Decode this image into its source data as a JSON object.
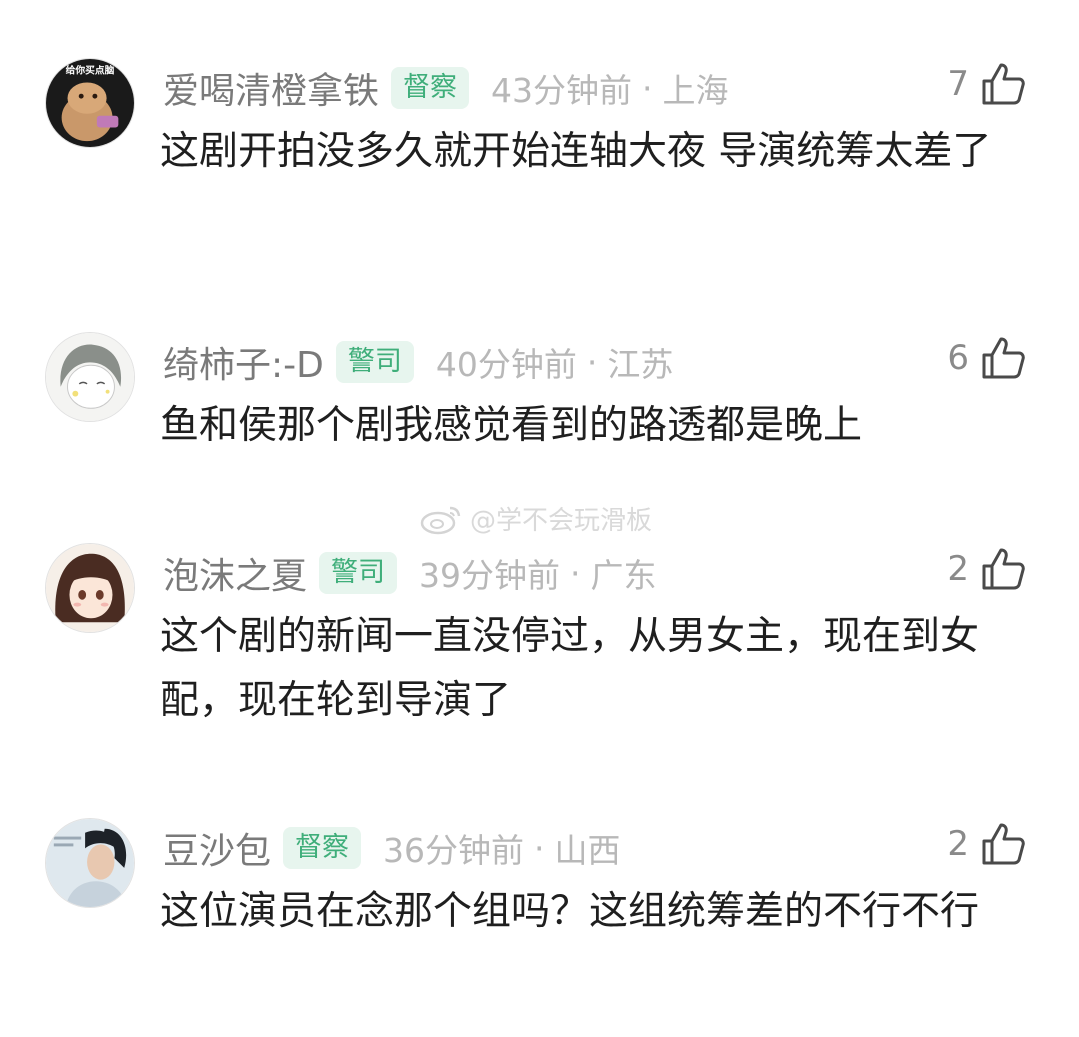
{
  "comments": [
    {
      "username": "爱喝清橙拿铁",
      "badge": "督察",
      "time": "43分钟前",
      "separator": "·",
      "location": "上海",
      "likes": "7",
      "content": "这剧开拍没多久就开始连轴大夜 导演统筹太差了",
      "avatar_text": "给你买点脑"
    },
    {
      "username": "绮柿子:-D",
      "badge": "警司",
      "time": "40分钟前",
      "separator": "·",
      "location": "江苏",
      "likes": "6",
      "content": "鱼和侯那个剧我感觉看到的路透都是晚上"
    },
    {
      "username": "泡沫之夏",
      "badge": "警司",
      "time": "39分钟前",
      "separator": "·",
      "location": "广东",
      "likes": "2",
      "content": "这个剧的新闻一直没停过，从男女主，现在到女配，现在轮到导演了"
    },
    {
      "username": "豆沙包",
      "badge": "督察",
      "time": "36分钟前",
      "separator": "·",
      "location": "山西",
      "likes": "2",
      "content": "这位演员在念那个组吗？这组统筹差的不行不行"
    }
  ],
  "watermark": "@学不会玩滑板",
  "colors": {
    "badge_bg": "#e7f5ee",
    "badge_text": "#3fae7a",
    "username": "#7a7a7a",
    "meta": "#b8b8b8",
    "content": "#1f1f1f"
  },
  "icons": [
    "thumbs-up-icon",
    "weibo-icon"
  ]
}
